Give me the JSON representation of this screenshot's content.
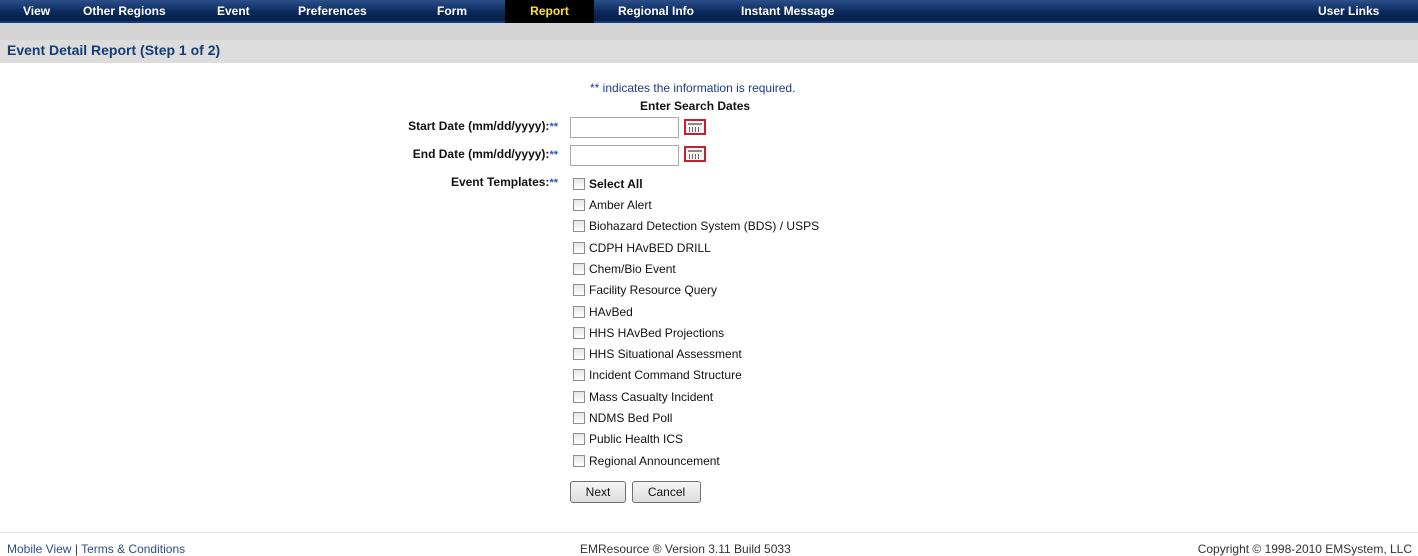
{
  "nav": {
    "items": [
      {
        "label": "View"
      },
      {
        "label": "Other Regions"
      },
      {
        "label": "Event"
      },
      {
        "label": "Preferences"
      },
      {
        "label": "Form"
      },
      {
        "label": "Report",
        "active": true
      },
      {
        "label": "Regional Info"
      },
      {
        "label": "Instant Message"
      }
    ],
    "user_links": "User Links"
  },
  "page": {
    "title": "Event Detail Report (Step 1 of 2)"
  },
  "form": {
    "required_note": "** indicates the information is required.",
    "search_heading": "Enter Search Dates",
    "required_marker": "**",
    "start_date_label": "Start Date (mm/dd/yyyy):",
    "start_date_value": "",
    "end_date_label": "End Date (mm/dd/yyyy):",
    "end_date_value": "",
    "templates_label": "Event Templates:",
    "select_all_label": "Select All",
    "templates": [
      "Amber Alert",
      "Biohazard Detection System (BDS) / USPS",
      "CDPH HAvBED DRILL",
      "Chem/Bio Event",
      "Facility Resource Query",
      "HAvBed",
      "HHS HAvBed Projections",
      "HHS Situational Assessment",
      "Incident Command Structure",
      "Mass Casualty Incident",
      "NDMS Bed Poll",
      "Public Health ICS",
      "Regional Announcement"
    ],
    "next_label": "Next",
    "cancel_label": "Cancel"
  },
  "footer": {
    "mobile_view": "Mobile View",
    "separator": "|",
    "terms": "Terms & Conditions",
    "version": "EMResource ® Version 3.11 Build 5033",
    "copyright": "Copyright © 1998-2010 EMSystem, LLC"
  },
  "colors": {
    "nav_bg": "#0b2a5e",
    "active_tab_text": "#ffe033",
    "title_text": "#143d75",
    "required_marker": "#3355bb",
    "calendar_border": "#c0232b"
  },
  "icons": {
    "calendar": "calendar-icon"
  }
}
